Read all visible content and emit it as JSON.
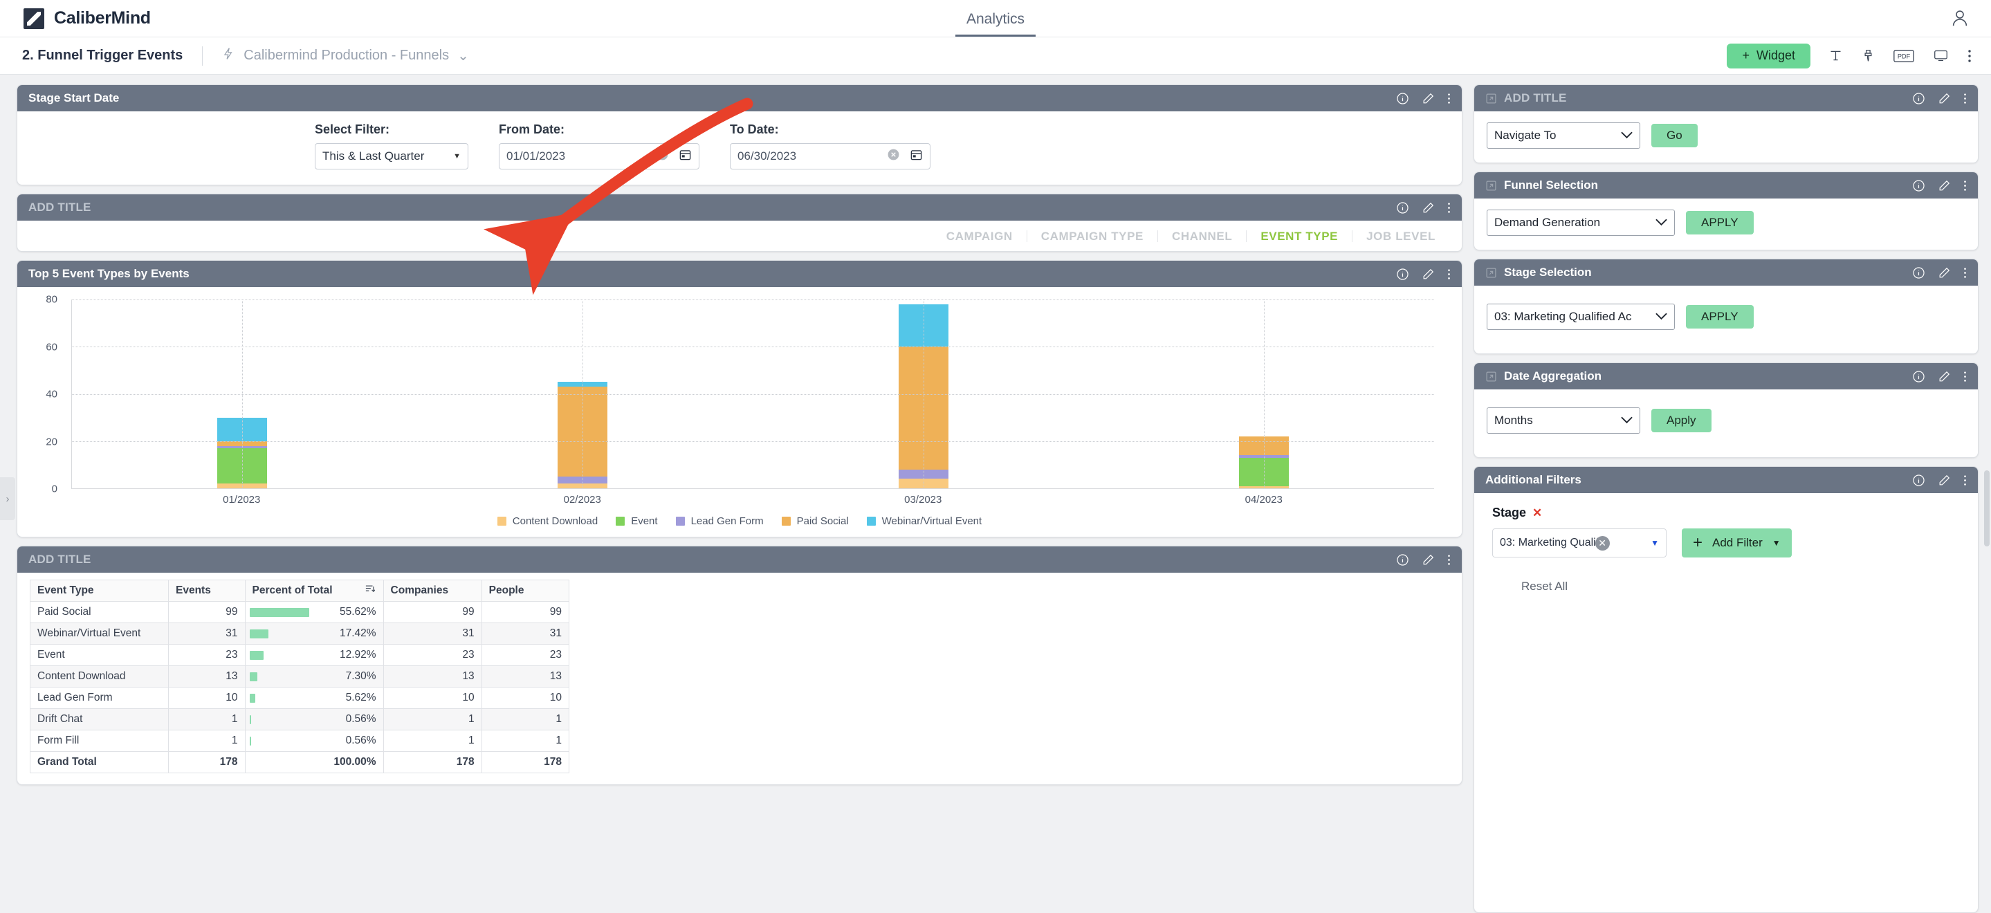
{
  "app": {
    "brand": "CaliberMind",
    "nav_tab": "Analytics",
    "user_icon": "user-avatar-icon"
  },
  "toolbar": {
    "dashboard_title": "2. Funnel Trigger Events",
    "source_icon": "lightning-bolt-icon",
    "source_label": "Calibermind Production - Funnels",
    "source_caret": "⌄",
    "widget_button": "Widget",
    "widget_plus": "+",
    "icons": [
      "text-icon",
      "paintbrush-icon",
      "pdf-icon",
      "presentation-icon",
      "more-vertical-icon"
    ],
    "pdf_label": "PDF"
  },
  "widget_header_icons": {
    "info": "info-icon",
    "edit": "pencil-icon",
    "more": "more-vertical-icon",
    "link": "external-link-icon"
  },
  "stage_start_date": {
    "title": "Stage Start Date",
    "select_filter_label": "Select Filter:",
    "select_filter_value": "This & Last Quarter",
    "from_date_label": "From Date:",
    "from_date_value": "01/01/2023",
    "to_date_label": "To Date:",
    "to_date_value": "06/30/2023",
    "clear_icon": "clear-circle-icon",
    "calendar_icon": "calendar-icon",
    "caret": "▼"
  },
  "dimension_tabs": {
    "title": "ADD TITLE",
    "tabs": [
      {
        "label": "CAMPAIGN",
        "active": false
      },
      {
        "label": "CAMPAIGN TYPE",
        "active": false
      },
      {
        "label": "CHANNEL",
        "active": false
      },
      {
        "label": "EVENT TYPE",
        "active": true
      },
      {
        "label": "JOB LEVEL",
        "active": false
      }
    ],
    "active_color": "#8ec63f"
  },
  "chart_card": {
    "title": "Top 5 Event Types by Events"
  },
  "chart_data": {
    "type": "bar",
    "stacked": true,
    "title": "Top 5 Event Types by Events",
    "xlabel": "",
    "ylabel": "",
    "categories": [
      "01/2023",
      "02/2023",
      "03/2023",
      "04/2023"
    ],
    "yticks": [
      0,
      20,
      40,
      60,
      80
    ],
    "ylim": [
      0,
      80
    ],
    "grid": true,
    "legend_position": "bottom",
    "series": [
      {
        "name": "Content Download",
        "color": "#f9c97e",
        "values": [
          2,
          2,
          4,
          1
        ]
      },
      {
        "name": "Event",
        "color": "#80d25b",
        "values": [
          15,
          0,
          0,
          12
        ]
      },
      {
        "name": "Lead Gen Form",
        "color": "#9f9ada",
        "values": [
          1,
          3,
          4,
          1
        ]
      },
      {
        "name": "Paid Social",
        "color": "#efb157",
        "values": [
          2,
          38,
          52,
          8
        ]
      },
      {
        "name": "Webinar/Virtual Event",
        "color": "#53c6e8",
        "values": [
          10,
          2,
          18,
          0
        ]
      }
    ]
  },
  "table_card": {
    "title": "ADD TITLE",
    "sort_icon": "sort-descending-icon",
    "columns": [
      "Event Type",
      "Events",
      "Percent of Total",
      "Companies",
      "People"
    ],
    "rows": [
      {
        "event_type": "Paid Social",
        "events": "99",
        "percent": "55.62%",
        "bar_pct": 55.62,
        "companies": "99",
        "people": "99"
      },
      {
        "event_type": "Webinar/Virtual Event",
        "events": "31",
        "percent": "17.42%",
        "bar_pct": 17.42,
        "companies": "31",
        "people": "31"
      },
      {
        "event_type": "Event",
        "events": "23",
        "percent": "12.92%",
        "bar_pct": 12.92,
        "companies": "23",
        "people": "23"
      },
      {
        "event_type": "Content Download",
        "events": "13",
        "percent": "7.30%",
        "bar_pct": 7.3,
        "companies": "13",
        "people": "13"
      },
      {
        "event_type": "Lead Gen Form",
        "events": "10",
        "percent": "5.62%",
        "bar_pct": 5.62,
        "companies": "10",
        "people": "10"
      },
      {
        "event_type": "Drift Chat",
        "events": "1",
        "percent": "0.56%",
        "bar_pct": 1.6,
        "companies": "1",
        "people": "1"
      },
      {
        "event_type": "Form Fill",
        "events": "1",
        "percent": "0.56%",
        "bar_pct": 1.6,
        "companies": "1",
        "people": "1"
      },
      {
        "event_type": "Grand Total",
        "events": "178",
        "percent": "100.00%",
        "bar_pct": 0,
        "companies": "178",
        "people": "178"
      }
    ]
  },
  "right_panels": {
    "navigate": {
      "title": "ADD TITLE",
      "select_value": "Navigate To",
      "button": "Go"
    },
    "funnel_selection": {
      "title": "Funnel Selection",
      "select_value": "Demand Generation",
      "button": "APPLY"
    },
    "stage_selection": {
      "title": "Stage Selection",
      "select_value": "03: Marketing Qualified Ac",
      "button": "APPLY"
    },
    "date_aggregation": {
      "title": "Date Aggregation",
      "select_value": "Months",
      "button": "Apply"
    },
    "additional_filters": {
      "title": "Additional Filters",
      "stage_label": "Stage",
      "stage_remove": "✕",
      "chip_value": "03: Marketing Qualifi..",
      "chip_clear": "✕",
      "add_filter": "Add Filter",
      "add_filter_plus": "+",
      "add_filter_caret": "▼",
      "reset_all": "Reset All"
    }
  },
  "annotation": {
    "arrow_color": "#e8402a",
    "description": "red-arrow-annotation"
  },
  "side_handle": {
    "icon": "chevron-right-icon",
    "glyph": "›"
  }
}
